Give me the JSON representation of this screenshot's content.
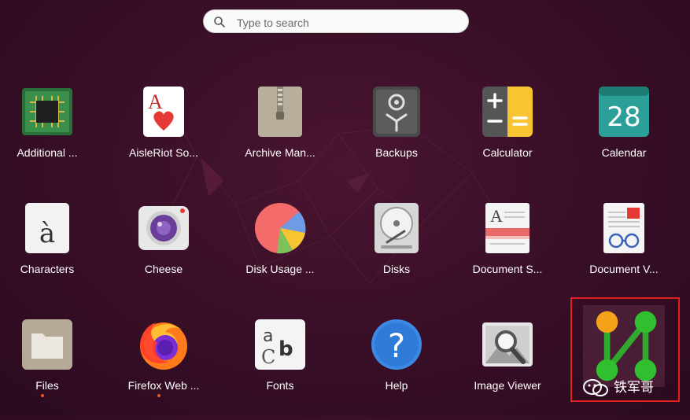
{
  "search": {
    "placeholder": "Type to search"
  },
  "apps": [
    {
      "label": "Additional ...",
      "icon": "chip-icon"
    },
    {
      "label": "AisleRiot So...",
      "icon": "playing-card-icon"
    },
    {
      "label": "Archive Man...",
      "icon": "archive-zipper-icon"
    },
    {
      "label": "Backups",
      "icon": "safe-icon"
    },
    {
      "label": "Calculator",
      "icon": "calculator-icon"
    },
    {
      "label": "Calendar",
      "icon": "calendar-icon",
      "day": "28"
    },
    {
      "label": "Characters",
      "icon": "character-map-icon",
      "glyph": "à"
    },
    {
      "label": "Cheese",
      "icon": "webcam-icon"
    },
    {
      "label": "Disk Usage ...",
      "icon": "pie-chart-icon"
    },
    {
      "label": "Disks",
      "icon": "hard-disk-icon"
    },
    {
      "label": "Document S...",
      "icon": "scanner-icon"
    },
    {
      "label": "Document V...",
      "icon": "document-viewer-icon"
    },
    {
      "label": "Files",
      "icon": "folder-icon"
    },
    {
      "label": "Firefox Web ...",
      "icon": "firefox-icon"
    },
    {
      "label": "Fonts",
      "icon": "fonts-icon",
      "glyph_a": "a",
      "glyph_b": "b",
      "glyph_c": "C"
    },
    {
      "label": "Help",
      "icon": "help-icon",
      "glyph": "?"
    },
    {
      "label": "Image Viewer",
      "icon": "image-viewer-icon"
    },
    {
      "label": "",
      "icon": "network-graph-icon"
    }
  ],
  "running": [
    "Files",
    "Firefox Web ..."
  ],
  "watermark": {
    "text": "铁军哥"
  },
  "colors": {
    "accent": "#e95420",
    "highlight": "#e02020",
    "calculator_yellow": "#f6c531",
    "calendar_teal": "#2ba098"
  }
}
